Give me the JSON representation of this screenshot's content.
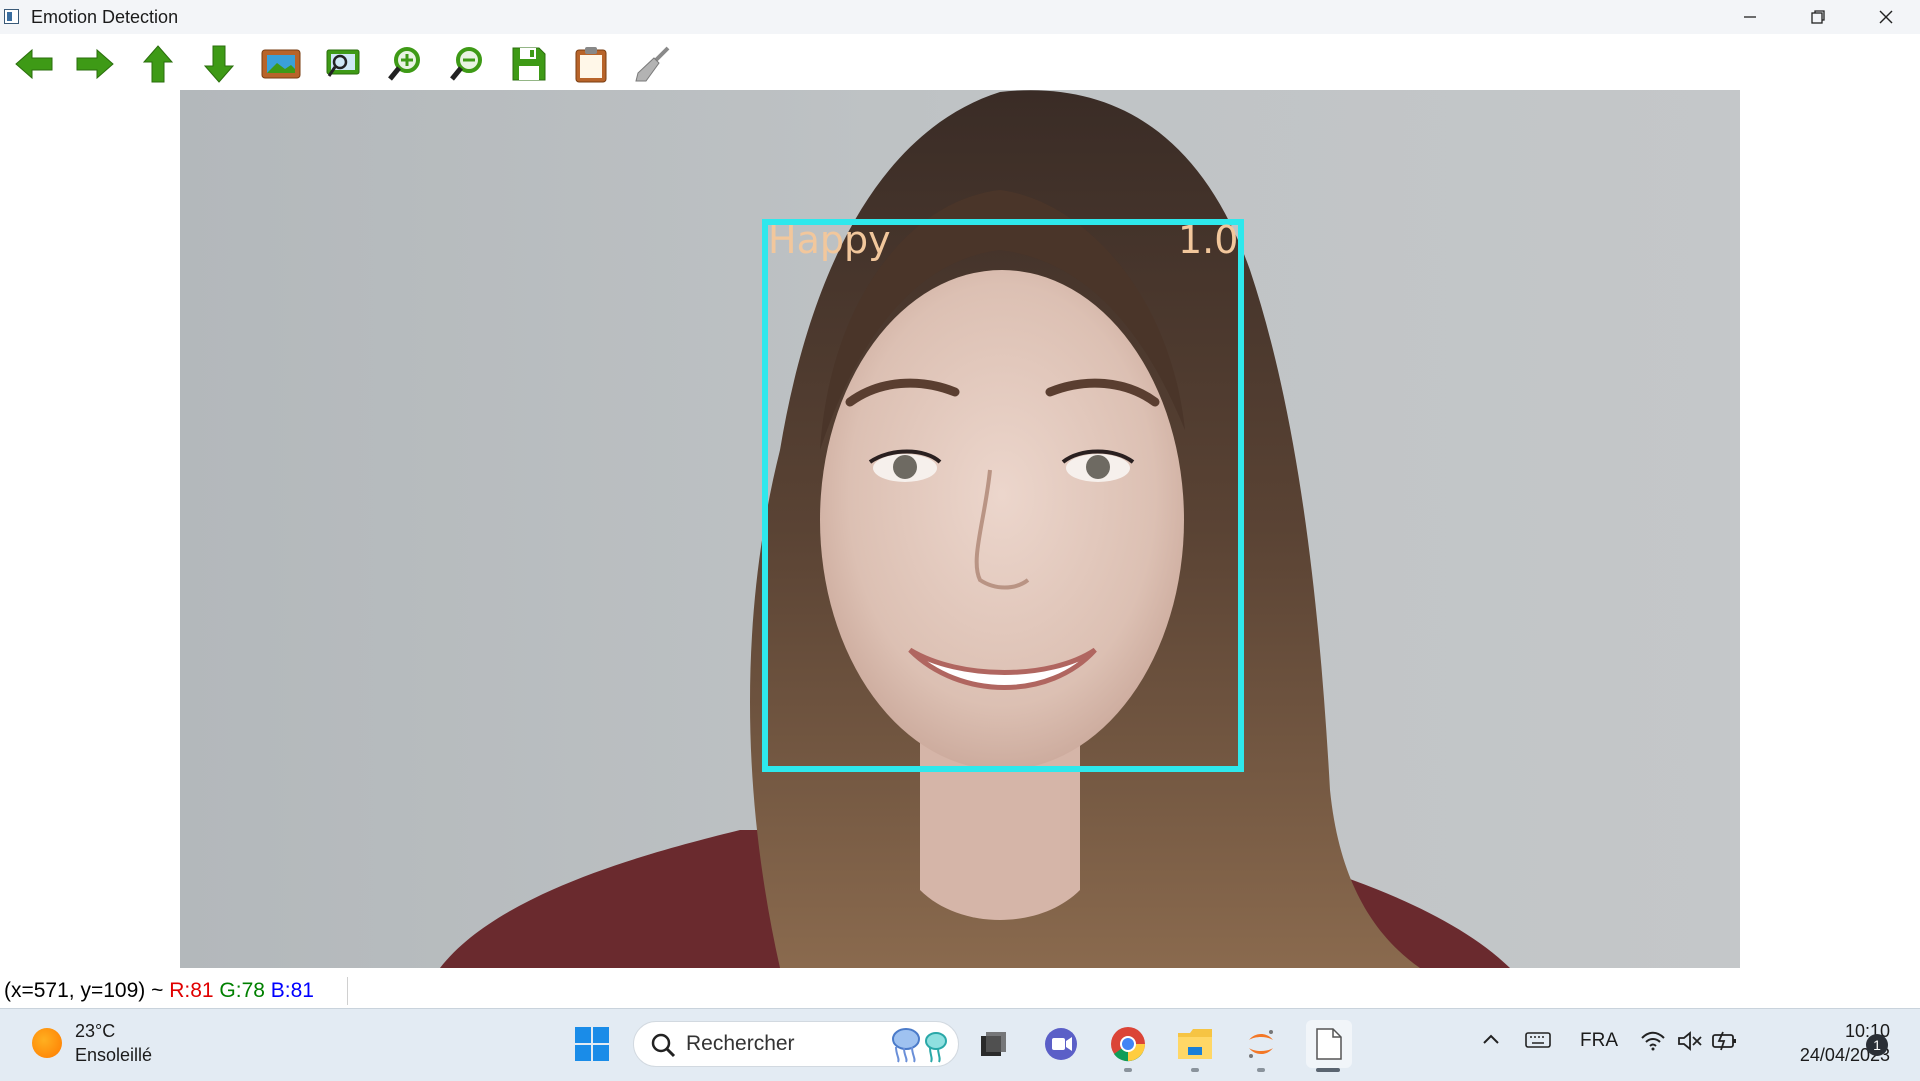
{
  "window": {
    "title": "Emotion Detection",
    "controls": [
      "minimize-icon",
      "restore-icon",
      "close-icon"
    ]
  },
  "toolbar": {
    "buttons": [
      {
        "icon": "arrow-left-icon",
        "color": "#3e9a16"
      },
      {
        "icon": "arrow-right-icon",
        "color": "#3e9a16"
      },
      {
        "icon": "arrow-up-icon",
        "color": "#3e9a16"
      },
      {
        "icon": "arrow-down-icon",
        "color": "#3e9a16"
      },
      {
        "icon": "image-icon",
        "color": "#b8642a"
      },
      {
        "icon": "zoom-fit-icon",
        "color": "#3e9a16"
      },
      {
        "icon": "zoom-in-icon",
        "color": "#3e9a16"
      },
      {
        "icon": "zoom-out-icon",
        "color": "#3e9a16"
      },
      {
        "icon": "save-icon",
        "color": "#3e9a16"
      },
      {
        "icon": "clipboard-icon",
        "color": "#b8642a"
      },
      {
        "icon": "brush-icon",
        "color": "#9a9a9a"
      }
    ]
  },
  "image": {
    "description_icon": "person-photo",
    "detection": {
      "emotion": "Happy",
      "score": "1.0",
      "box_color": "#2ee8ec",
      "label_color": "#f2c79c"
    }
  },
  "status": {
    "coords": "(x=571, y=109) ~",
    "r": "R:81",
    "g": "G:78",
    "b": "B:81",
    "r_color": "#e00000",
    "g_color": "#008000",
    "b_color": "#0000ff"
  },
  "taskbar": {
    "weather_temp": "23°C",
    "weather_desc": "Ensoleillé",
    "search_placeholder": "Rechercher",
    "apps": [
      "start-icon",
      "task-view-icon",
      "teams-icon",
      "chrome-icon",
      "file-explorer-icon",
      "jupyter-icon",
      "document-icon"
    ],
    "language": "FRA",
    "time": "10:10",
    "date": "24/04/2023",
    "notifications": "1"
  }
}
